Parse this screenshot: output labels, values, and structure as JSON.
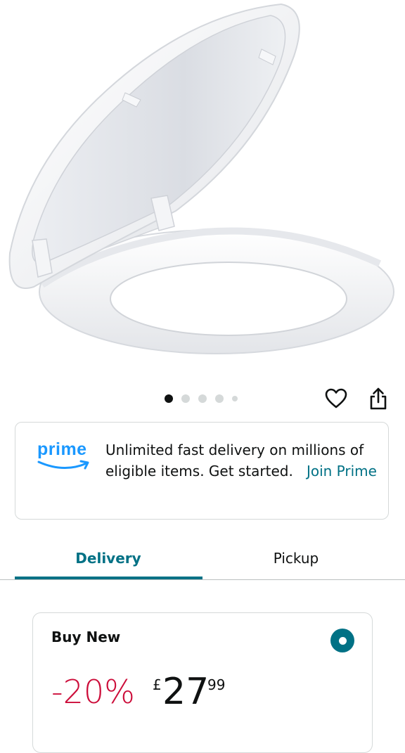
{
  "product_image": {
    "alt": "white toilet seat with lid open",
    "carousel_total": 5,
    "carousel_active_index": 0
  },
  "actions": {
    "favorite_icon": "heart-outline-icon",
    "share_icon": "share-icon"
  },
  "prime_banner": {
    "logo_text": "prime",
    "message": "Unlimited fast delivery on millions of eligible items. Get started.",
    "link": "Join Prime",
    "logo_color": "#1a98ff",
    "link_color": "#007185"
  },
  "tabs": [
    {
      "label": "Delivery",
      "selected": true
    },
    {
      "label": "Pickup",
      "selected": false
    }
  ],
  "buy_box": {
    "title": "Buy New",
    "selected": true,
    "discount": "-20%",
    "currency": "£",
    "price_whole": "27",
    "price_fraction": "99",
    "discount_color": "#cc0c39"
  }
}
